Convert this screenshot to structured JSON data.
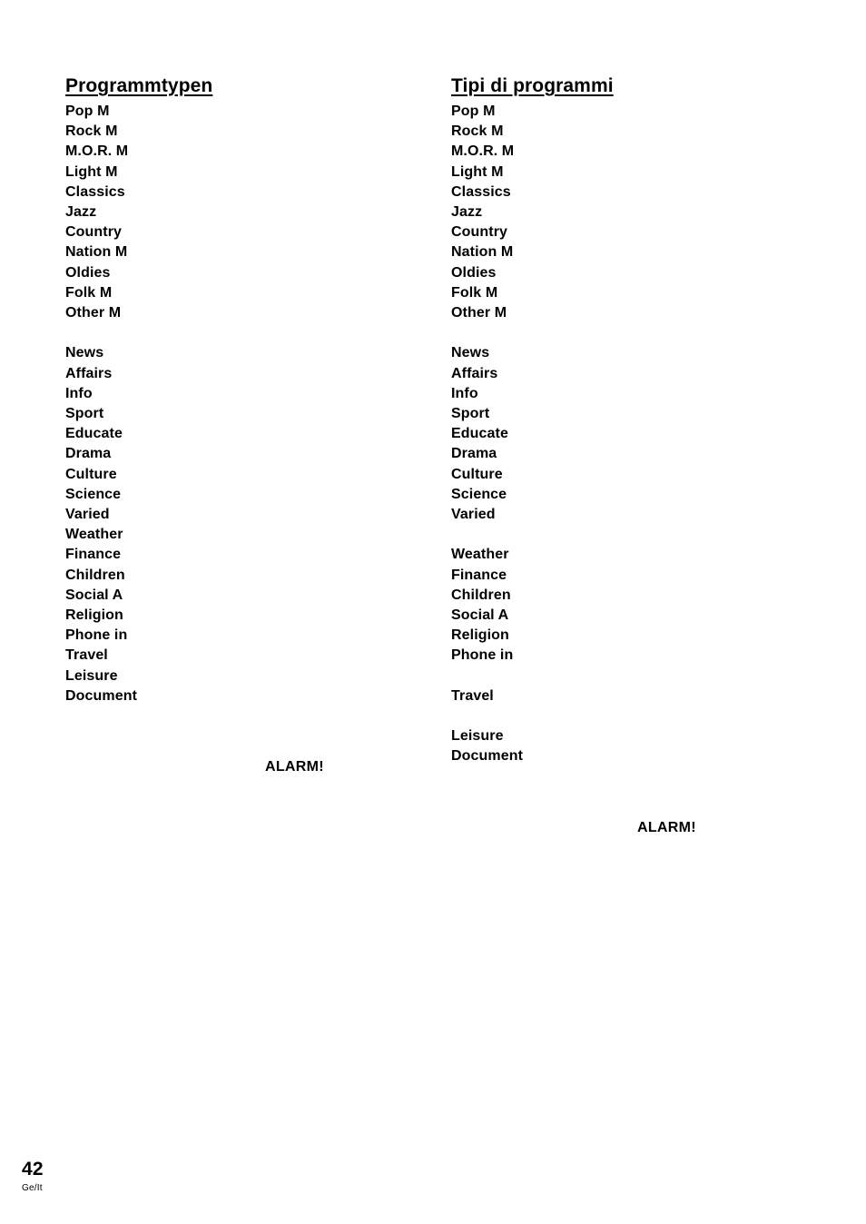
{
  "document": {
    "page_number": "42",
    "language_code": "Ge/It"
  },
  "columns": [
    {
      "id": "german",
      "heading": "Programmtypen",
      "items": [
        "Pop M",
        "Rock M",
        "M.O.R. M",
        "Light M",
        "Classics",
        "Jazz",
        "Country",
        "Nation M",
        "Oldies",
        "Folk M",
        "Other M",
        "",
        "News",
        "Affairs",
        "Info",
        "Sport",
        "Educate",
        "Drama",
        "Culture",
        "Science",
        "Varied",
        "Weather",
        "Finance",
        "Children",
        "Social A",
        "Religion",
        "Phone in",
        "Travel",
        "Leisure",
        "Document"
      ],
      "alarm_label": "ALARM!"
    },
    {
      "id": "italian",
      "heading": "Tipi di programmi",
      "items": [
        "Pop M",
        "Rock M",
        "M.O.R. M",
        "Light M",
        "Classics",
        "Jazz",
        "Country",
        "Nation M",
        "Oldies",
        "Folk M",
        "Other M",
        "",
        "News",
        "Affairs",
        "Info",
        "Sport",
        "Educate",
        "Drama",
        "Culture",
        "Science",
        "Varied",
        "",
        "Weather",
        "Finance",
        "Children",
        "Social A",
        "Religion",
        "Phone in",
        "",
        "Travel",
        "",
        "Leisure",
        "Document"
      ],
      "alarm_label": "ALARM!"
    }
  ]
}
